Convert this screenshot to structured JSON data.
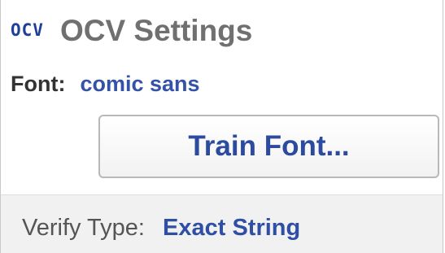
{
  "header": {
    "icon_text": "OCV",
    "icon": "ocv-icon",
    "title": "OCV Settings"
  },
  "font": {
    "label": "Font:",
    "value": "comic sans"
  },
  "train_button": {
    "label": "Train Font..."
  },
  "verify": {
    "label": "Verify Type:",
    "value": "Exact String"
  },
  "colors": {
    "accent_blue": "#2e4fa3",
    "title_gray": "#707070",
    "section_bg": "#f1f1f1"
  }
}
